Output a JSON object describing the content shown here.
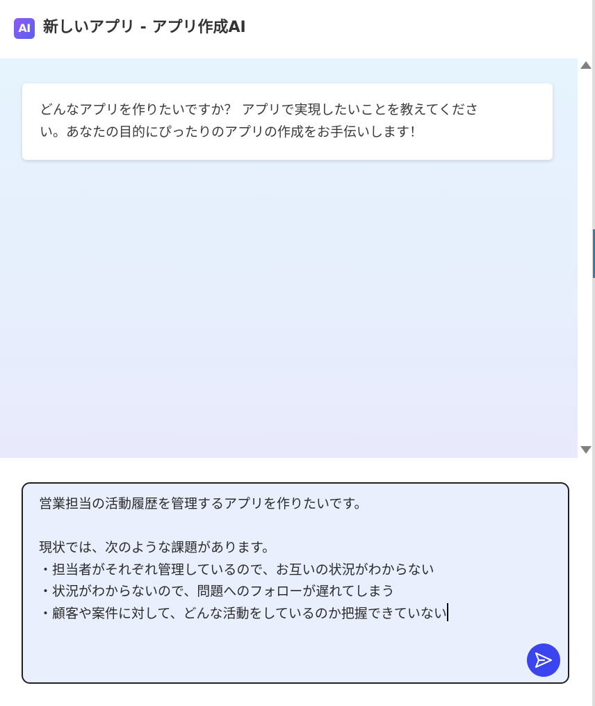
{
  "header": {
    "logo_text": "AI",
    "title": "新しいアプリ - アプリ作成AI"
  },
  "chat": {
    "messages": [
      {
        "role": "assistant",
        "line1": "どんなアプリを作りたいですか？ アプリで実現したいことを教えてくださ",
        "line2": "い。あなたの目的にぴったりのアプリの作成をお手伝いします！"
      }
    ]
  },
  "input": {
    "lines": [
      "営業担当の活動履歴を管理するアプリを作りたいです。",
      "",
      "現状では、次のような課題があります。",
      "・担当者がそれぞれ管理しているので、お互いの状況がわからない",
      "・状況がわからないので、問題へのフォローが遅れてしまう",
      "・顧客や案件に対して、どんな活動をしているのか把握できていない"
    ],
    "send_icon": "send-arrow-icon"
  },
  "colors": {
    "accent": "#3a45f0",
    "logo_gradient_start": "#8b5cf6",
    "logo_gradient_end": "#5b5ff0",
    "chat_bg_top": "#e5f4fd",
    "chat_bg_bottom": "#e8eafc",
    "input_bg": "#e9effd"
  }
}
